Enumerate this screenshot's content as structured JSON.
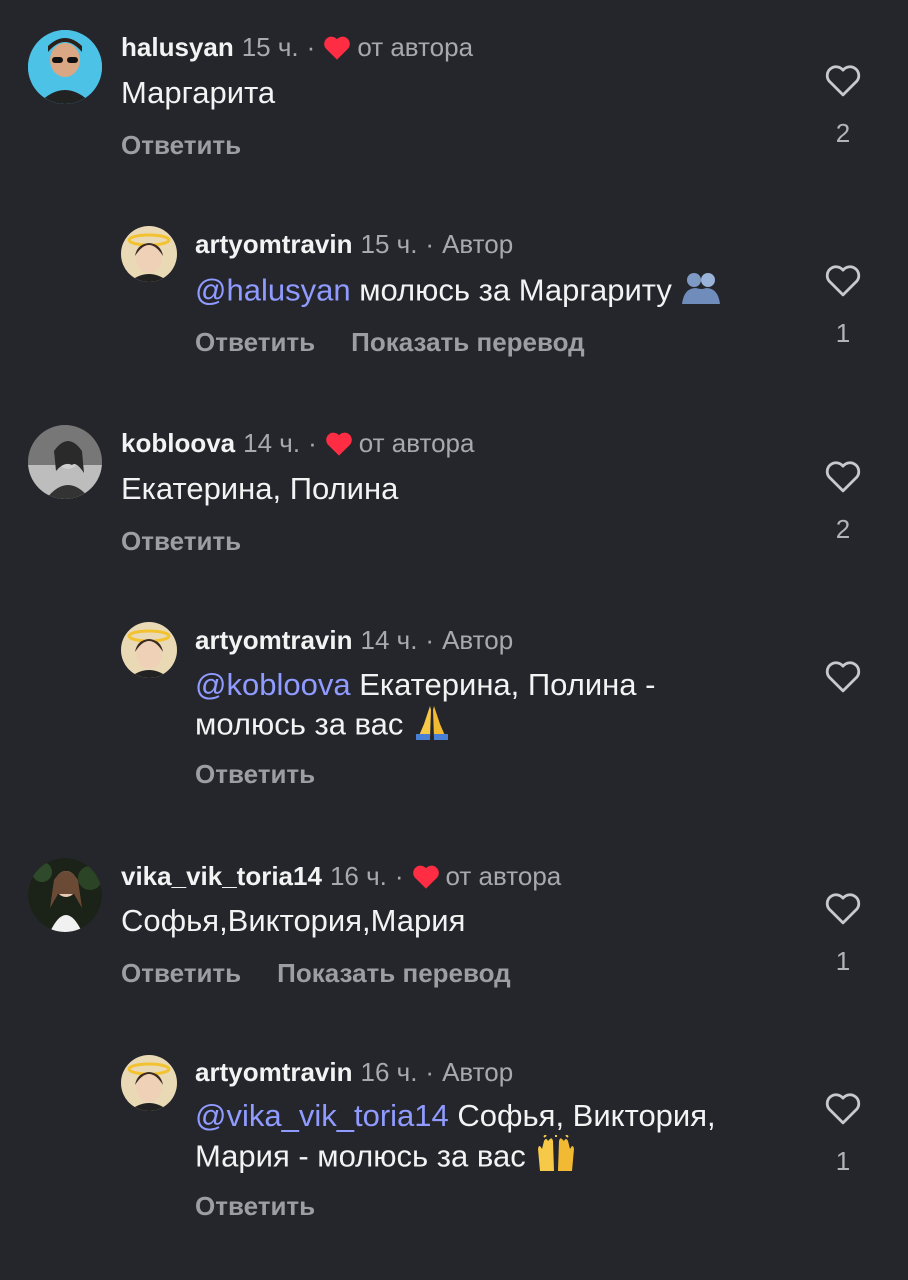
{
  "comments": [
    {
      "user": "halusyan",
      "time": "15 ч.",
      "badge": "от автора",
      "text": "Маргарита",
      "actions": [
        "Ответить"
      ],
      "likes": "2",
      "reply": {
        "user": "artyomtravin",
        "time": "15 ч.",
        "badge": "Автор",
        "mention": "@halusyan",
        "text": "молюсь за Маргариту",
        "emoji": "hugging-people-icon",
        "actions": [
          "Ответить",
          "Показать перевод"
        ],
        "likes": "1"
      }
    },
    {
      "user": "kobloova",
      "time": "14 ч.",
      "badge": "от автора",
      "text": "Екатерина, Полина",
      "actions": [
        "Ответить"
      ],
      "likes": "2",
      "reply": {
        "user": "artyomtravin",
        "time": "14 ч.",
        "badge": "Автор",
        "mention": "@kobloova",
        "text": "Екатерина, Полина -",
        "text2": "молюсь за вас",
        "emoji": "folded-hands-icon",
        "actions": [
          "Ответить"
        ],
        "likes": ""
      }
    },
    {
      "user": "vika_vik_toria14",
      "time": "16 ч.",
      "badge": "от автора",
      "text": "Софья,Виктория,Мария",
      "actions": [
        "Ответить",
        "Показать перевод"
      ],
      "likes": "1",
      "reply": {
        "user": "artyomtravin",
        "time": "16 ч.",
        "badge": "Автор",
        "mention": "@vika_vik_toria14",
        "text": "Софья, Виктория,",
        "text2": "Мария - молюсь за вас",
        "emoji": "raising-hands-icon",
        "actions": [
          "Ответить"
        ],
        "likes": "1"
      }
    }
  ],
  "colors": {
    "background": "#25262b",
    "mention": "#8f9bff",
    "heart_red": "#ff2d43"
  }
}
